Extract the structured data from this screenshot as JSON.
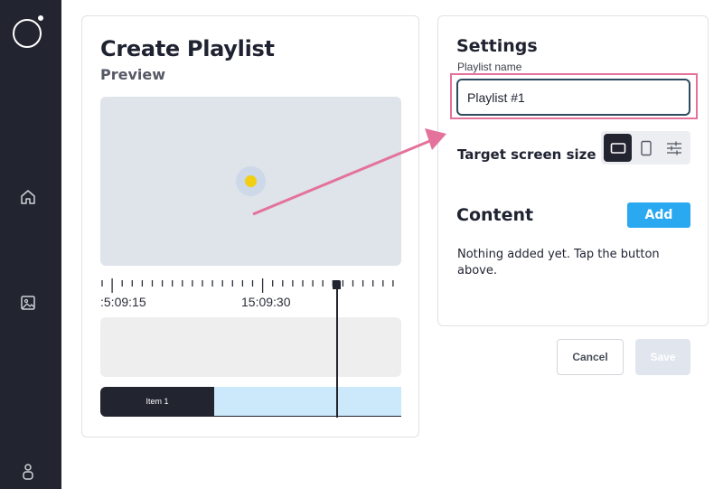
{
  "sidebar": {
    "icons": [
      "app-logo-icon",
      "home-icon",
      "image-icon",
      "user-icon"
    ]
  },
  "editor": {
    "title": "Create Playlist",
    "preview_label": "Preview",
    "timeline": {
      "start_label": ":5:09:15",
      "mid_label": "15:09:30",
      "item_label": "Item 1"
    }
  },
  "settings": {
    "title": "Settings",
    "playlist_name_label": "Playlist name",
    "playlist_name_value": "Playlist #1",
    "target_screen_label": "Target screen size",
    "screen_options": [
      {
        "icon": "landscape-screen-icon",
        "selected": true
      },
      {
        "icon": "portrait-screen-icon",
        "selected": false
      },
      {
        "icon": "sliders-icon",
        "selected": false
      }
    ]
  },
  "content": {
    "title": "Content",
    "add_label": "Add",
    "empty_text": "Nothing added yet. Tap the button above."
  },
  "actions": {
    "cancel_label": "Cancel",
    "save_label": "Save"
  },
  "colors": {
    "sidebar": "#22252f",
    "accent": "#2aa8f0",
    "highlight": "#e4729b",
    "marker": "#f2cf12"
  }
}
